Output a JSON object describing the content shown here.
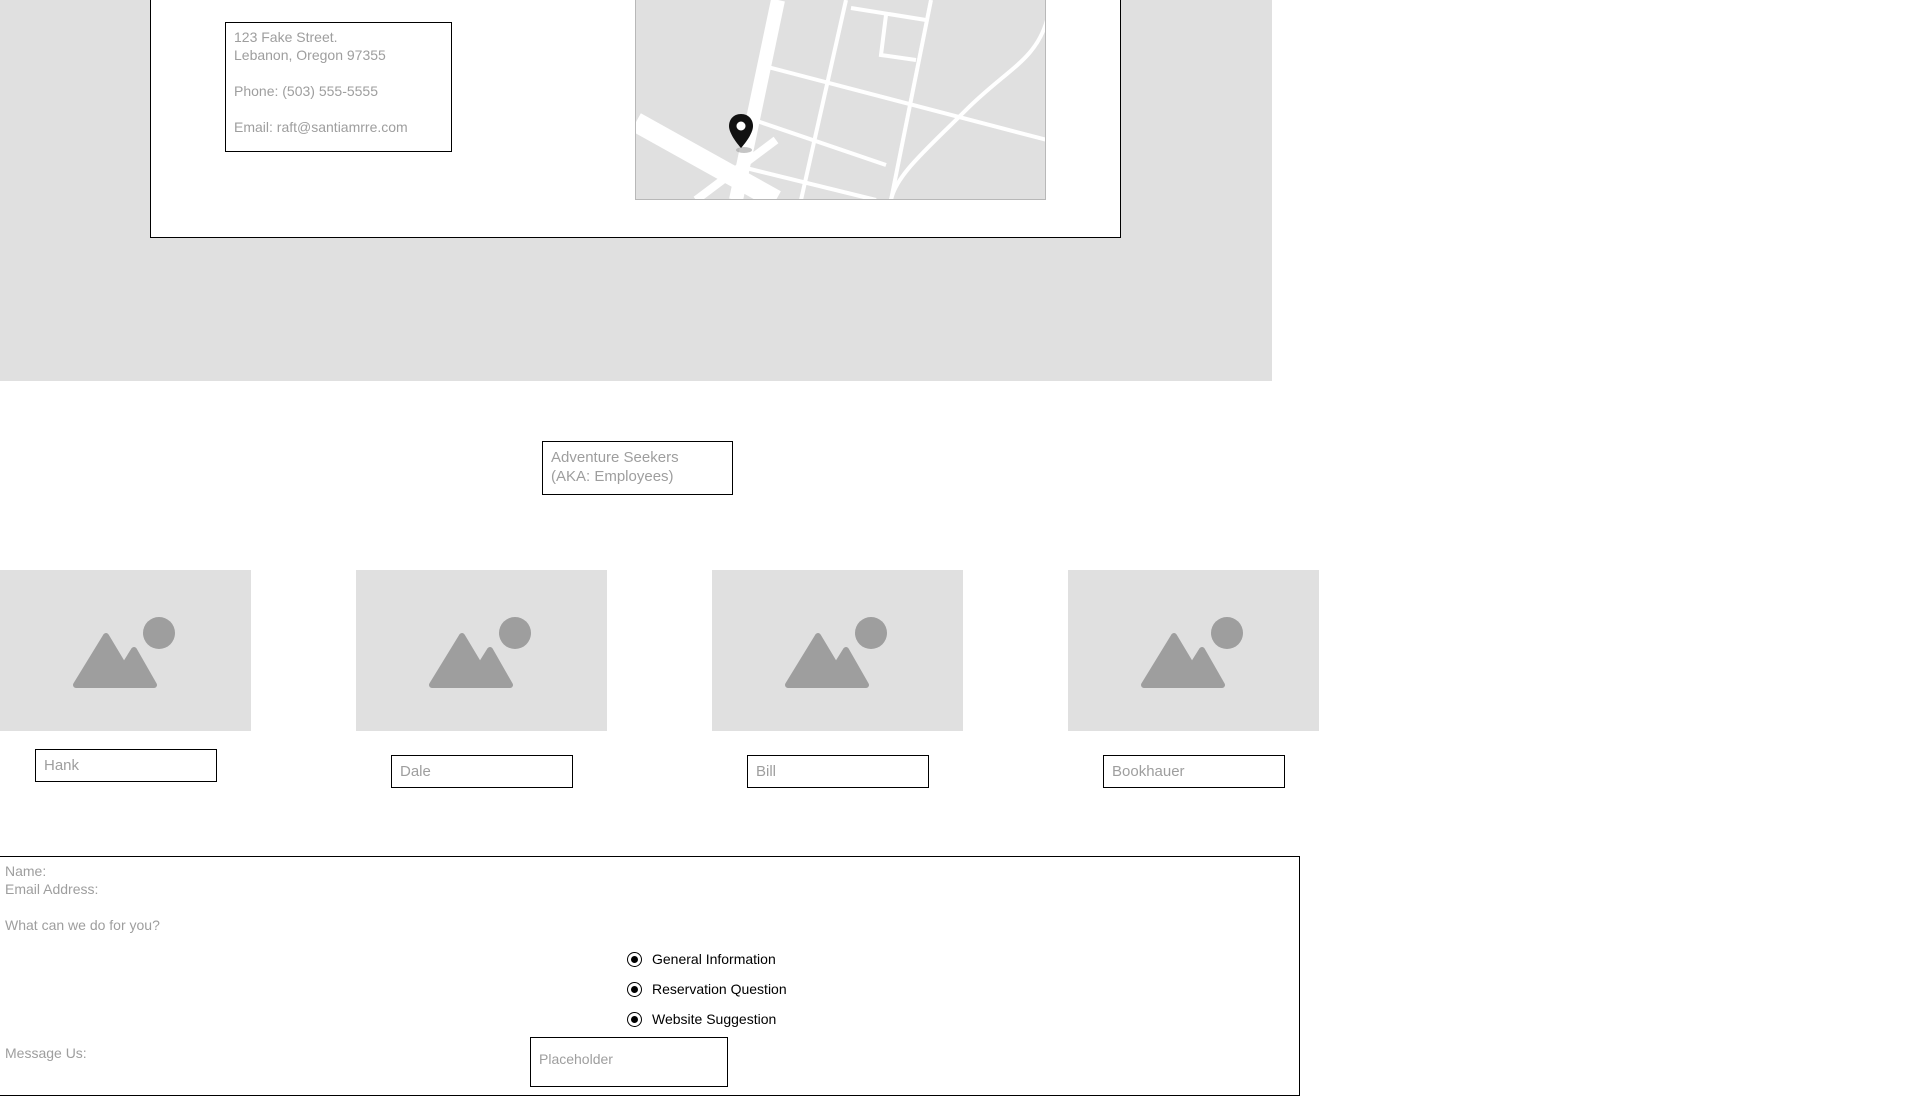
{
  "contact": {
    "address_line1": "123 Fake Street.",
    "address_line2": "Lebanon, Oregon 97355",
    "phone": "Phone: (503) 555-5555",
    "email": "Email: raft@santiamrre.com"
  },
  "map": {
    "icon": "map-pin-icon"
  },
  "team": {
    "heading_line1": "Adventure Seekers",
    "heading_line2": "(AKA: Employees)",
    "members": [
      {
        "name": "Hank",
        "icon": "image-placeholder-icon"
      },
      {
        "name": "Dale",
        "icon": "image-placeholder-icon"
      },
      {
        "name": "Bill",
        "icon": "image-placeholder-icon"
      },
      {
        "name": "Bookhauer",
        "icon": "image-placeholder-icon"
      }
    ]
  },
  "form": {
    "name_label": "Name:",
    "email_label": "Email Address:",
    "question_label": "What can we do for you?",
    "options": [
      {
        "label": "General Information",
        "selected": true
      },
      {
        "label": "Reservation Question",
        "selected": true
      },
      {
        "label": "Website Suggestion",
        "selected": true
      }
    ],
    "message_label": "Message Us:",
    "message_placeholder": "Placeholder"
  },
  "colors": {
    "placeholder_gray": "#e0e0e0",
    "text_gray": "#9e9e9e",
    "icon_gray": "#9e9e9e"
  }
}
